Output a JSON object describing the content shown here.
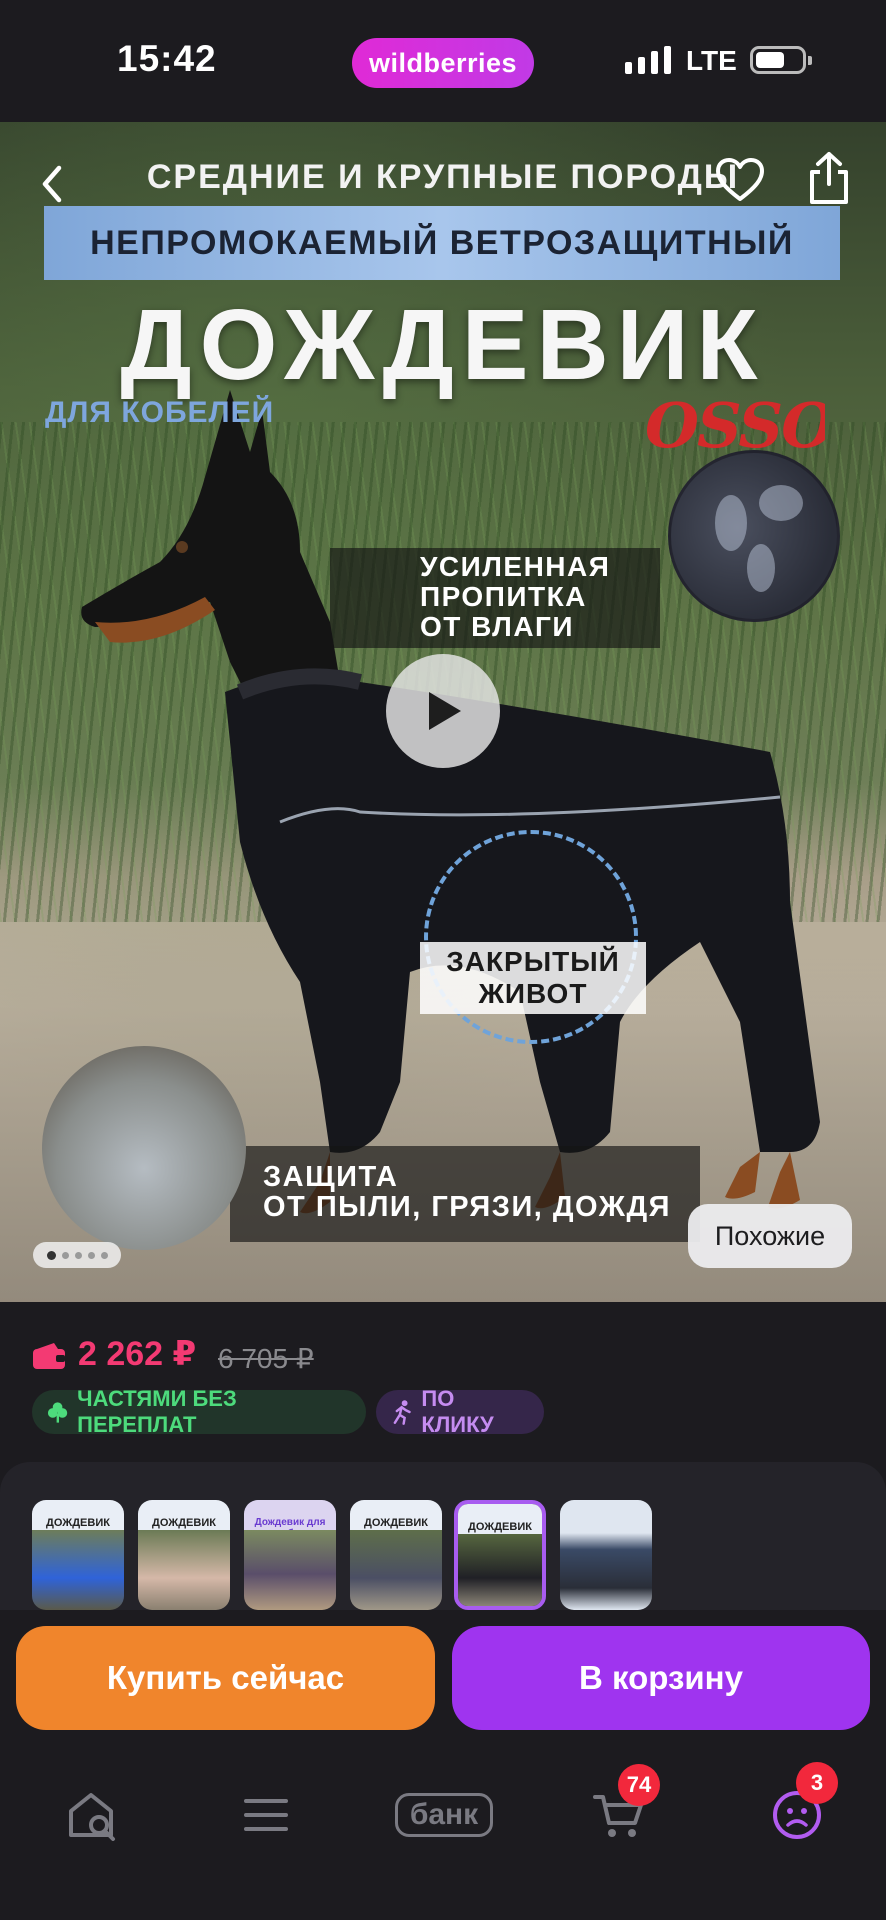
{
  "status_bar": {
    "time": "15:42",
    "brand": "wildberries",
    "network": "LTE",
    "icons": [
      "signal-icon",
      "battery-icon"
    ]
  },
  "product_image": {
    "subtitle": "СРЕДНИЕ И КРУПНЫЕ ПОРОДЫ",
    "banner": "НЕПРОМОКАЕМЫЙ ВЕТРОЗАЩИТНЫЙ",
    "product_word": "ДОЖДЕВИК",
    "for_males": "ДЛЯ КОБЕЛЕЙ",
    "logo": "OSSO",
    "feature_1": [
      "УСИЛЕННАЯ",
      "ПРОПИТКА",
      "ОТ ВЛАГИ"
    ],
    "feature_2": [
      "ЗАКРЫТЫЙ",
      "ЖИВОТ"
    ],
    "feature_3": [
      "ЗАЩИТА",
      "ОТ ПЫЛИ, ГРЯЗИ, ДОЖДЯ"
    ],
    "similar_button": "Похожие",
    "pager": {
      "count": 5,
      "active": 1
    }
  },
  "price": {
    "current": "2 262 ₽",
    "old": "6 705 ₽",
    "chips": [
      {
        "label": "ЧАСТЯМИ БЕЗ ПЕРЕПЛАТ",
        "icon": "clover-icon",
        "color": "#4ddb7c"
      },
      {
        "label": "ПО КЛИКУ",
        "icon": "running-person-icon",
        "color": "#c58cf0"
      }
    ]
  },
  "thumbnails": [
    {
      "title": "ДОЖДЕВИК",
      "color": "#2f63d9",
      "active": false
    },
    {
      "title": "ДОЖДЕВИК",
      "color": "#d5b8a8",
      "active": false
    },
    {
      "title": "Дождевик для собак",
      "color": "#5a4e6a",
      "active": false
    },
    {
      "title": "ДОЖДЕВИК",
      "color": "#4b4f64",
      "active": false
    },
    {
      "title": "ДОЖДЕВИК",
      "color": "#202026",
      "active": true
    },
    {
      "title": "",
      "color": "#3a4a66",
      "active": false
    }
  ],
  "actions": {
    "buy_now": "Купить сейчас",
    "add_to_cart": "В корзину"
  },
  "bottom_nav": {
    "bank_label": "банк",
    "cart_badge": "74",
    "profile_badge": "3",
    "icons": [
      "home-search-icon",
      "menu-icon",
      "bank-icon",
      "cart-icon",
      "profile-icon"
    ]
  },
  "colors": {
    "background": "#1c1b1f",
    "price": "#f33a73",
    "buy_button": "#f0852c",
    "cart_button": "#9f34ef",
    "brand_pill": "#e02ad6",
    "badge": "#f2283c"
  }
}
